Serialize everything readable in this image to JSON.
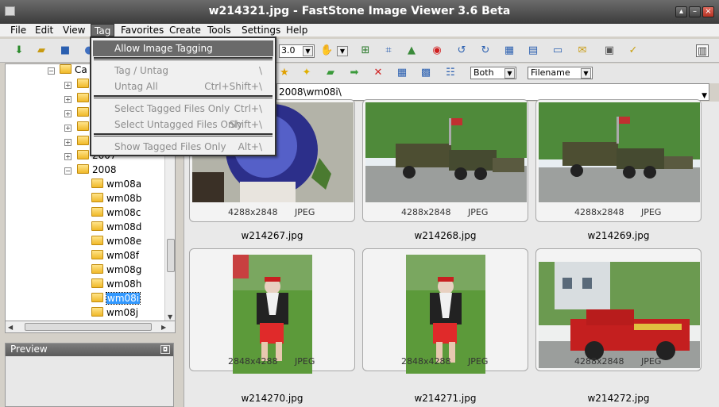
{
  "window": {
    "title": "w214321.jpg  -  FastStone Image Viewer 3.6 Beta"
  },
  "menubar": [
    "File",
    "Edit",
    "View",
    "Tag",
    "Favorites",
    "Create",
    "Tools",
    "Settings",
    "Help"
  ],
  "tag_menu": {
    "items": [
      {
        "label": "Allow Image Tagging",
        "shortcut": ""
      },
      {
        "label": "Tag / Untag",
        "shortcut": "\\"
      },
      {
        "label": "Untag All",
        "shortcut": "Ctrl+Shift+\\"
      },
      {
        "label": "Select Tagged Files Only",
        "shortcut": "Ctrl+\\"
      },
      {
        "label": "Select Untagged Files Only",
        "shortcut": "Shift+\\"
      },
      {
        "label": "Show Tagged Files Only",
        "shortcut": "Alt+\\"
      }
    ]
  },
  "toolbar": {
    "zoom_value": "3.0"
  },
  "filter": {
    "type_value": "Both",
    "sort_value": "Filename"
  },
  "path": {
    "value": "2008\\wm08i\\"
  },
  "tree": {
    "root_partial": "Ca",
    "year_partial": "2007",
    "year": "2008",
    "folders": [
      "wm08a",
      "wm08b",
      "wm08c",
      "wm08d",
      "wm08e",
      "wm08f",
      "wm08g",
      "wm08h",
      "wm08i",
      "wm08j"
    ],
    "selected": "wm08i"
  },
  "preview": {
    "title": "Preview"
  },
  "thumbnails": [
    {
      "filename": "w214267.jpg",
      "dims": "4288x2848",
      "format": "JPEG"
    },
    {
      "filename": "w214268.jpg",
      "dims": "4288x2848",
      "format": "JPEG"
    },
    {
      "filename": "w214269.jpg",
      "dims": "4288x2848",
      "format": "JPEG"
    },
    {
      "filename": "w214270.jpg",
      "dims": "2848x4288",
      "format": "JPEG"
    },
    {
      "filename": "w214271.jpg",
      "dims": "2848x4288",
      "format": "JPEG"
    },
    {
      "filename": "w214272.jpg",
      "dims": "4288x2848",
      "format": "JPEG"
    }
  ]
}
